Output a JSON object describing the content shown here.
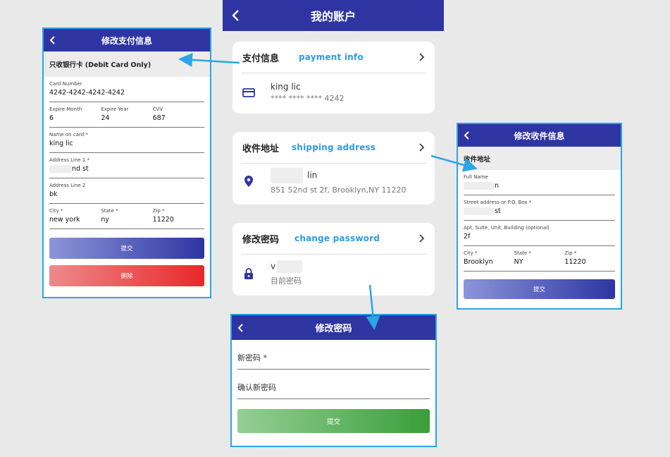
{
  "main": {
    "title": "我的账户",
    "payment": {
      "header": "支付信息",
      "tag": "payment info",
      "name": "king lic",
      "card": "**** **** **** 4242"
    },
    "shipping": {
      "header": "收件地址",
      "tag": "shipping address",
      "name_suffix": "lin",
      "address": "851 52nd st 2f, Brooklyn,NY 11220"
    },
    "password": {
      "header": "修改密码",
      "tag": "change password",
      "value_prefix": "v",
      "caption": "目前密码"
    }
  },
  "payment_panel": {
    "title": "修改支付信息",
    "section": "只收银行卡 (Debit Card Only)",
    "card_number_label": "Card Number",
    "card_number": "4242-4242-4242-4242",
    "expire_month_label": "Expire Month",
    "expire_month": "6",
    "expire_year_label": "Expire Year",
    "expire_year": "24",
    "cvv_label": "CVV",
    "cvv": "687",
    "name_label": "Name on card *",
    "name": "king lic",
    "addr1_label": "Address Line 1 *",
    "addr1_suffix": "nd st",
    "addr2_label": "Address Line 2",
    "addr2": "bk",
    "city_label": "City *",
    "city": "new york",
    "state_label": "State *",
    "state": "ny",
    "zip_label": "Zip *",
    "zip": "11220",
    "submit": "提交",
    "delete": "删除"
  },
  "shipping_panel": {
    "title": "修改收件信息",
    "section": "收件地址",
    "fullname_label": "Full Name",
    "fullname_suffix": "n",
    "street_label": "Street address or P.O. Box *",
    "street_suffix": "st",
    "apt_label": "Apt, Suite, Unit, Building (optional)",
    "apt": "2f",
    "city_label": "City *",
    "city": "Brooklyn",
    "state_label": "State *",
    "state": "NY",
    "zip_label": "Zip *",
    "zip": "11220",
    "submit": "提交"
  },
  "password_panel": {
    "title": "修改密码",
    "new_password": "新密码 *",
    "confirm_password": "确认新密码",
    "submit": "提交"
  },
  "colors": {
    "primary": "#2e35a3",
    "annotation": "#2aa5e8",
    "danger": "#e8282a",
    "success": "#3a9e3a"
  }
}
